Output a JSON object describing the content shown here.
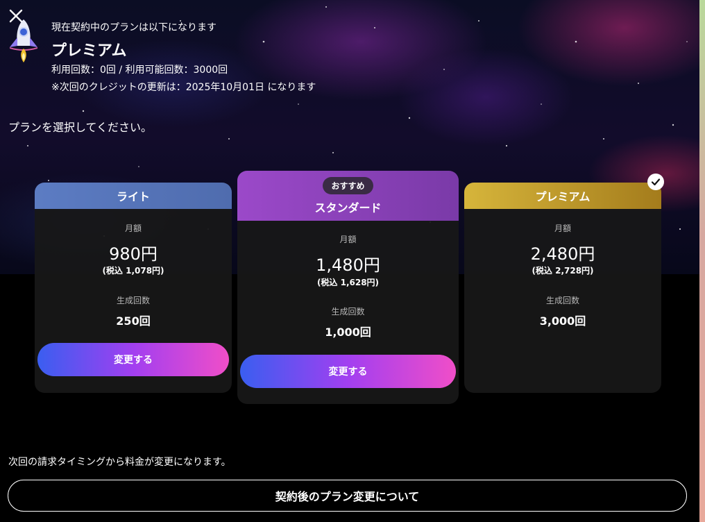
{
  "current_plan": {
    "intro": "現在契約中のプランは以下になります",
    "plan_name": "プレミアム",
    "usage": "利用回数：0回 / 利用可能回数：3000回",
    "renewal_note": "※次回のクレジットの更新は：2025年10月01日 になります"
  },
  "select_prompt": "プランを選択してください。",
  "plans": [
    {
      "name": "ライト",
      "price_label": "月額",
      "price": "980円",
      "price_tax": "(税込 1,078円)",
      "count_label": "生成回数",
      "count": "250回",
      "button_label": "変更する"
    },
    {
      "badge": "おすすめ",
      "name": "スタンダード",
      "price_label": "月額",
      "price": "1,480円",
      "price_tax": "(税込 1,628円)",
      "count_label": "生成回数",
      "count": "1,000回",
      "button_label": "変更する"
    },
    {
      "name": "プレミアム",
      "price_label": "月額",
      "price": "2,480円",
      "price_tax": "(税込 2,728円)",
      "count_label": "生成回数",
      "count": "3,000回",
      "selected": true
    }
  ],
  "footer": {
    "note": "次回の請求タイミングから料金が変更になります。",
    "about_button": "契約後のプラン変更について"
  },
  "icons": {
    "close": "close-icon",
    "rocket": "rocket-icon",
    "check": "check-icon"
  },
  "colors": {
    "lite_header": "#5c7cc3",
    "standard_header": "#9b49c9",
    "premium_header": "#d6b53b",
    "button_gradient": [
      "#3a5ef0",
      "#a23ff0",
      "#f04ec8"
    ]
  }
}
